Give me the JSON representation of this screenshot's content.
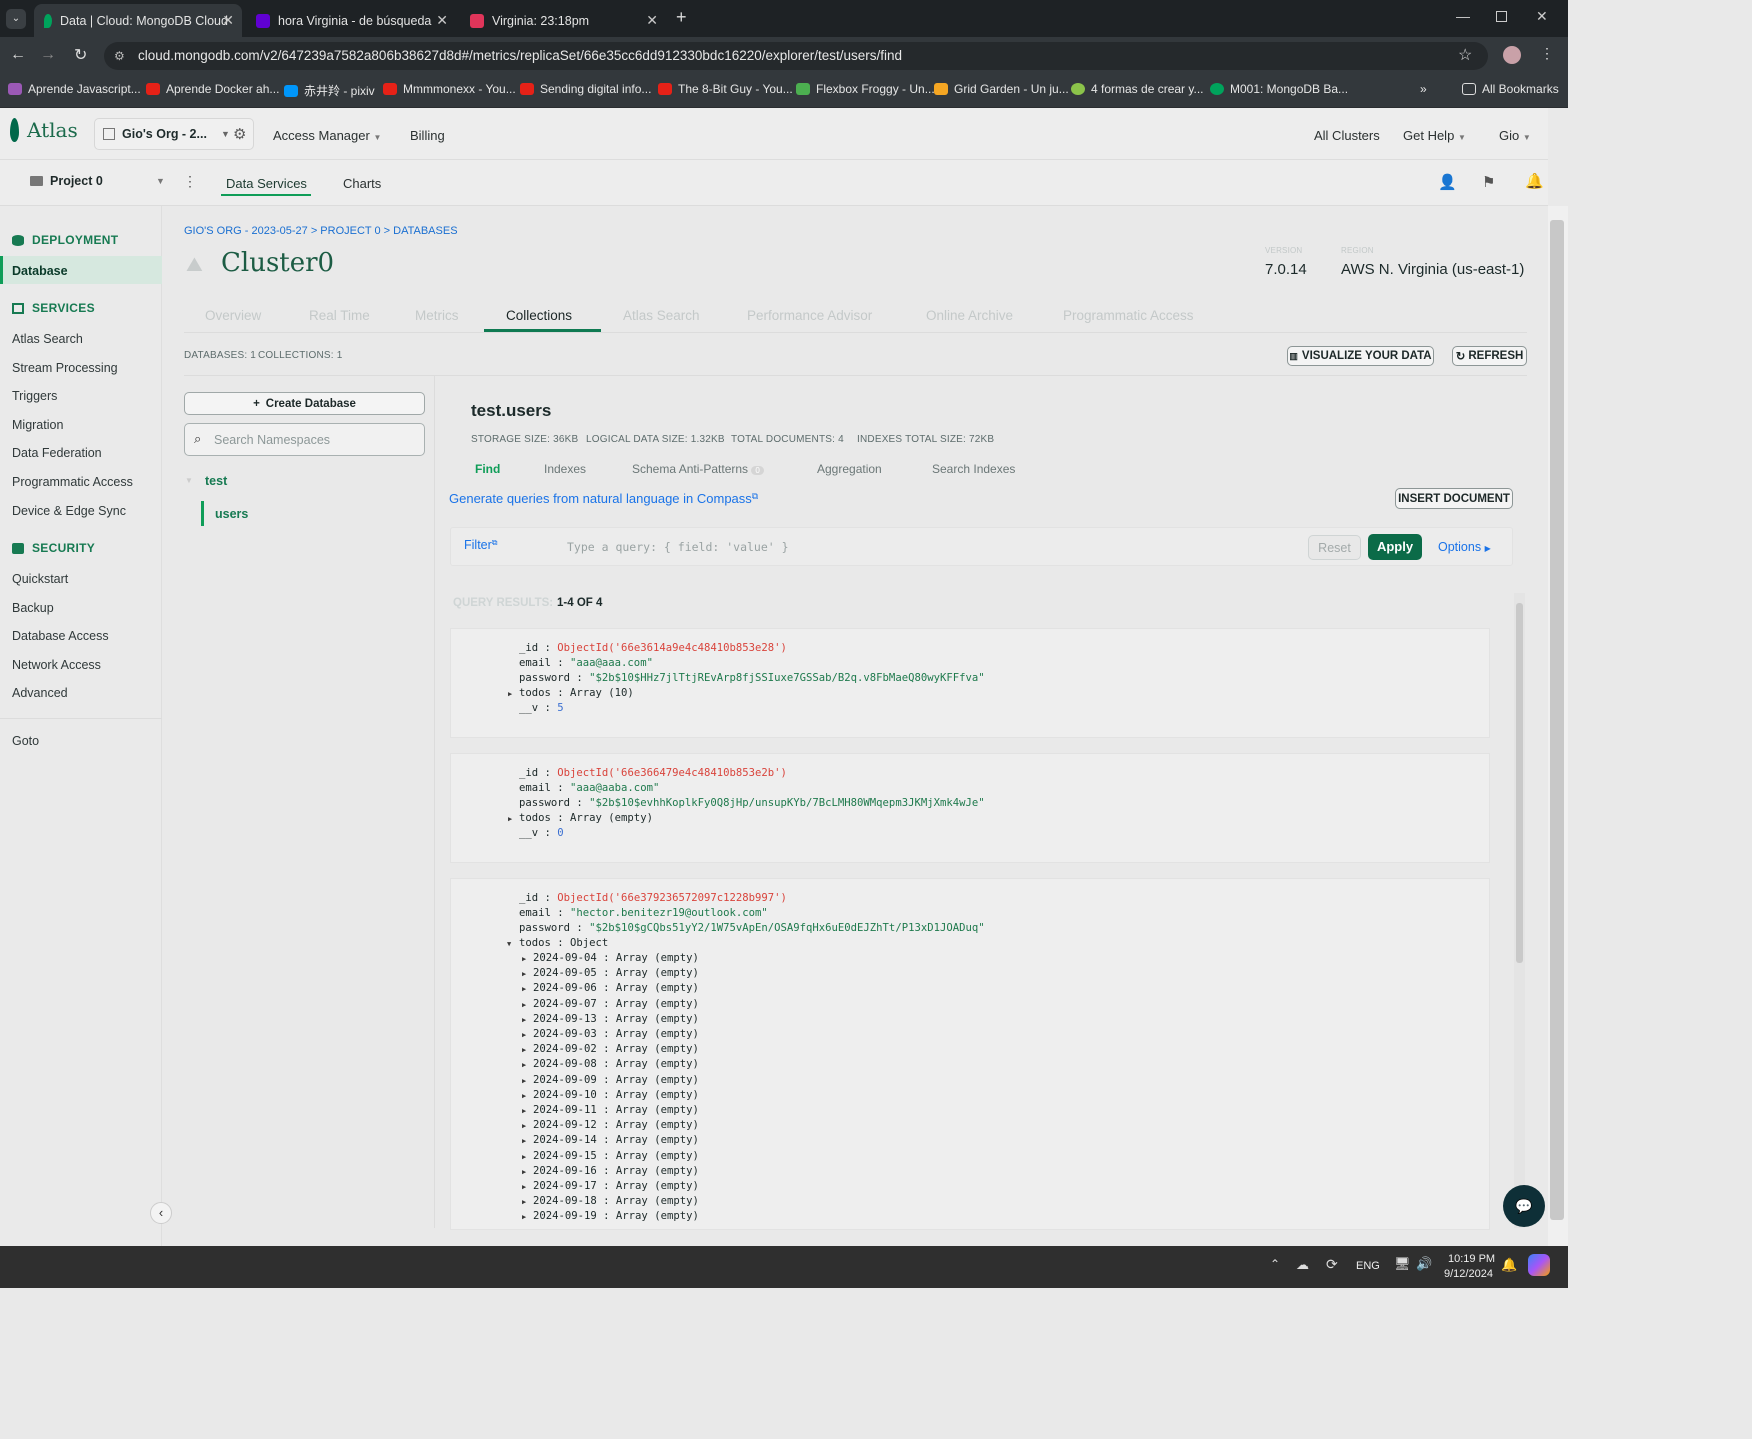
{
  "browser": {
    "tabs": [
      {
        "title": "Data | Cloud: MongoDB Cloud",
        "icon": "mongodb-leaf-icon"
      },
      {
        "title": "hora Virginia - de búsqueda",
        "icon": "yahoo-icon"
      },
      {
        "title": "Virginia: 23:18pm",
        "icon": "letter-l-icon"
      }
    ],
    "url": "cloud.mongodb.com/v2/647239a7582a806b38627d8d#/metrics/replicaSet/66e35cc6dd912330bdc16220/explorer/test/users/find",
    "bookmarks": [
      "Aprende Javascript...",
      "Aprende Docker ah...",
      "赤井羚 - pixiv",
      "Mmmmonexx - You...",
      "Sending digital info...",
      "The 8-Bit Guy - You...",
      "Flexbox Froggy - Un...",
      "Grid Garden - Un ju...",
      "4 formas de crear y...",
      "M001: MongoDB Ba..."
    ],
    "all_bookmarks": "All Bookmarks",
    "more": "»"
  },
  "atlas": {
    "logo": "Atlas",
    "org": "Gio's Org - 2...",
    "access_manager": "Access Manager",
    "billing": "Billing",
    "all_clusters": "All Clusters",
    "get_help": "Get Help",
    "user": "Gio",
    "project": "Project 0",
    "data_services": "Data Services",
    "charts": "Charts"
  },
  "sidebar": {
    "deployment": "DEPLOYMENT",
    "database": "Database",
    "services": "SERVICES",
    "services_items": [
      "Atlas Search",
      "Stream Processing",
      "Triggers",
      "Migration",
      "Data Federation",
      "Programmatic Access",
      "Device & Edge Sync"
    ],
    "security": "SECURITY",
    "security_items": [
      "Quickstart",
      "Backup",
      "Database Access",
      "Network Access",
      "Advanced"
    ],
    "goto": "Goto"
  },
  "main": {
    "breadcrumb": "GIO'S ORG - 2023-05-27 > PROJECT 0 > DATABASES",
    "cluster_name": "Cluster0",
    "version_label": "VERSION",
    "version": "7.0.14",
    "region_label": "REGION",
    "region": "AWS N. Virginia (us-east-1)",
    "tabs": [
      "Overview",
      "Real Time",
      "Metrics",
      "Collections",
      "Atlas Search",
      "Performance Advisor",
      "Online Archive",
      "Programmatic Access"
    ],
    "active_tab": "Collections",
    "databases_count": "DATABASES: 1",
    "collections_count": "COLLECTIONS: 1",
    "visualize": "VISUALIZE YOUR DATA",
    "refresh": "REFRESH",
    "create_db": "Create Database",
    "search_placeholder": "Search Namespaces",
    "db_name": "test",
    "coll_name": "users"
  },
  "collection": {
    "title": "test.users",
    "storage": "STORAGE SIZE: 36KB",
    "logical": "LOGICAL DATA SIZE: 1.32KB",
    "total_docs": "TOTAL DOCUMENTS: 4",
    "indexes_size": "INDEXES TOTAL SIZE: 72KB",
    "subtabs": [
      "Find",
      "Indexes",
      "Schema Anti-Patterns",
      "Aggregation",
      "Search Indexes"
    ],
    "anti_pattern_count": "0",
    "nl_link": "Generate queries from natural language in Compass",
    "insert": "INSERT DOCUMENT",
    "filter": "Filter",
    "query_placeholder": "Type a query: { field: 'value' }",
    "reset": "Reset",
    "apply": "Apply",
    "options": "Options",
    "results_label": "QUERY RESULTS:",
    "results_range": "1-4 OF 4"
  },
  "documents": [
    {
      "id": "ObjectId('66e3614a9e4c48410b853e28')",
      "email": "\"aaa@aaa.com\"",
      "password": "\"$2b$10$HHz7jlTtjREvArp8fjSSIuxe7GSSab/B2q.v8FbMaeQ80wyKFFfva\"",
      "todos": "Array (10)",
      "v": "5"
    },
    {
      "id": "ObjectId('66e366479e4c48410b853e2b')",
      "email": "\"aaa@aaba.com\"",
      "password": "\"$2b$10$evhhKoplkFy0Q8jHp/unsupKYb/7BcLMH80WMqepm3JKMjXmk4wJe\"",
      "todos": "Array (empty)",
      "v": "0"
    },
    {
      "id": "ObjectId('66e379236572097c1228b997')",
      "email": "\"hector.benitezr19@outlook.com\"",
      "password": "\"$2b$10$gCQbs51yY2/1W75vApEn/OSA9fqHx6uE0dEJZhTt/P13xD1JOADuq\"",
      "todos": "Object",
      "todo_dates": [
        "2024-09-04",
        "2024-09-05",
        "2024-09-06",
        "2024-09-07",
        "2024-09-13",
        "2024-09-03",
        "2024-09-02",
        "2024-09-08",
        "2024-09-09",
        "2024-09-10",
        "2024-09-11",
        "2024-09-12",
        "2024-09-14",
        "2024-09-15",
        "2024-09-16",
        "2024-09-17",
        "2024-09-18",
        "2024-09-19"
      ],
      "todo_value": "Array (empty)"
    }
  ],
  "field_names": {
    "id": "_id",
    "email": "email",
    "password": "password",
    "todos": "todos",
    "v": "__v"
  },
  "taskbar": {
    "lang": "ENG",
    "time": "10:19 PM",
    "date": "9/12/2024"
  },
  "colors": {
    "accent": "#00684a",
    "link": "#1a73e8",
    "oid": "#d9443c"
  }
}
